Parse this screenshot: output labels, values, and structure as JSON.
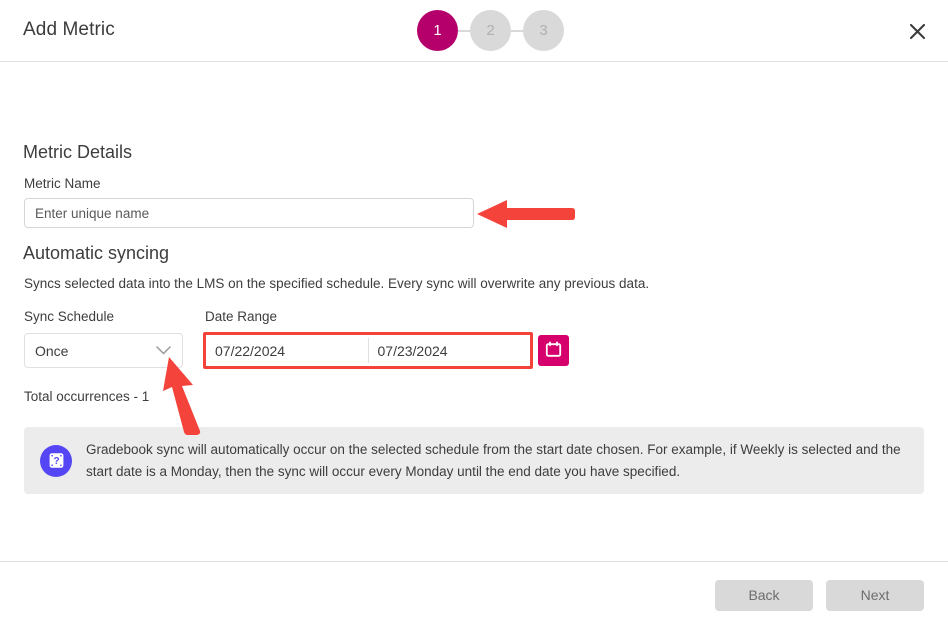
{
  "dialog": {
    "title": "Add Metric",
    "close_label": "close-icon"
  },
  "stepper": {
    "steps": [
      {
        "label": "1",
        "state": "active"
      },
      {
        "label": "2",
        "state": "inactive"
      },
      {
        "label": "3",
        "state": "inactive"
      }
    ],
    "active_color": "#b5006b",
    "inactive_color": "#d9d9d9"
  },
  "metric_details": {
    "heading": "Metric Details",
    "name_label": "Metric Name",
    "name_placeholder": "Enter unique name",
    "name_value": ""
  },
  "automatic_syncing": {
    "heading": "Automatic syncing",
    "description": "Syncs selected data into the LMS on the specified schedule. Every sync will overwrite any previous data.",
    "sync_schedule_label": "Sync Schedule",
    "sync_schedule_value": "Once",
    "sync_schedule_options": [
      "Once"
    ],
    "date_range_label": "Date Range",
    "start_date": "07/22/2024",
    "end_date": "07/23/2024",
    "calendar_icon": "calendar-icon",
    "calendar_button_color": "#d6006d",
    "total_occurrences": "Total occurrences - 1"
  },
  "info_banner": {
    "icon": "question-help-icon",
    "icon_color": "#5546f5",
    "background": "#ececec",
    "text": "Gradebook sync will automatically occur on the selected schedule from the start date chosen. For example, if Weekly is selected and the start date is a Monday, then the sync will occur every Monday until the end date you have specified."
  },
  "footer": {
    "back_label": "Back",
    "next_label": "Next",
    "button_color": "#d9d9d9"
  },
  "annotations": {
    "arrow_color": "#f4433a",
    "arrow_to_metric_name": "arrow-left-icon",
    "arrow_to_sync_schedule": "arrow-up-icon",
    "date_range_highlight_color": "#f4433a"
  }
}
